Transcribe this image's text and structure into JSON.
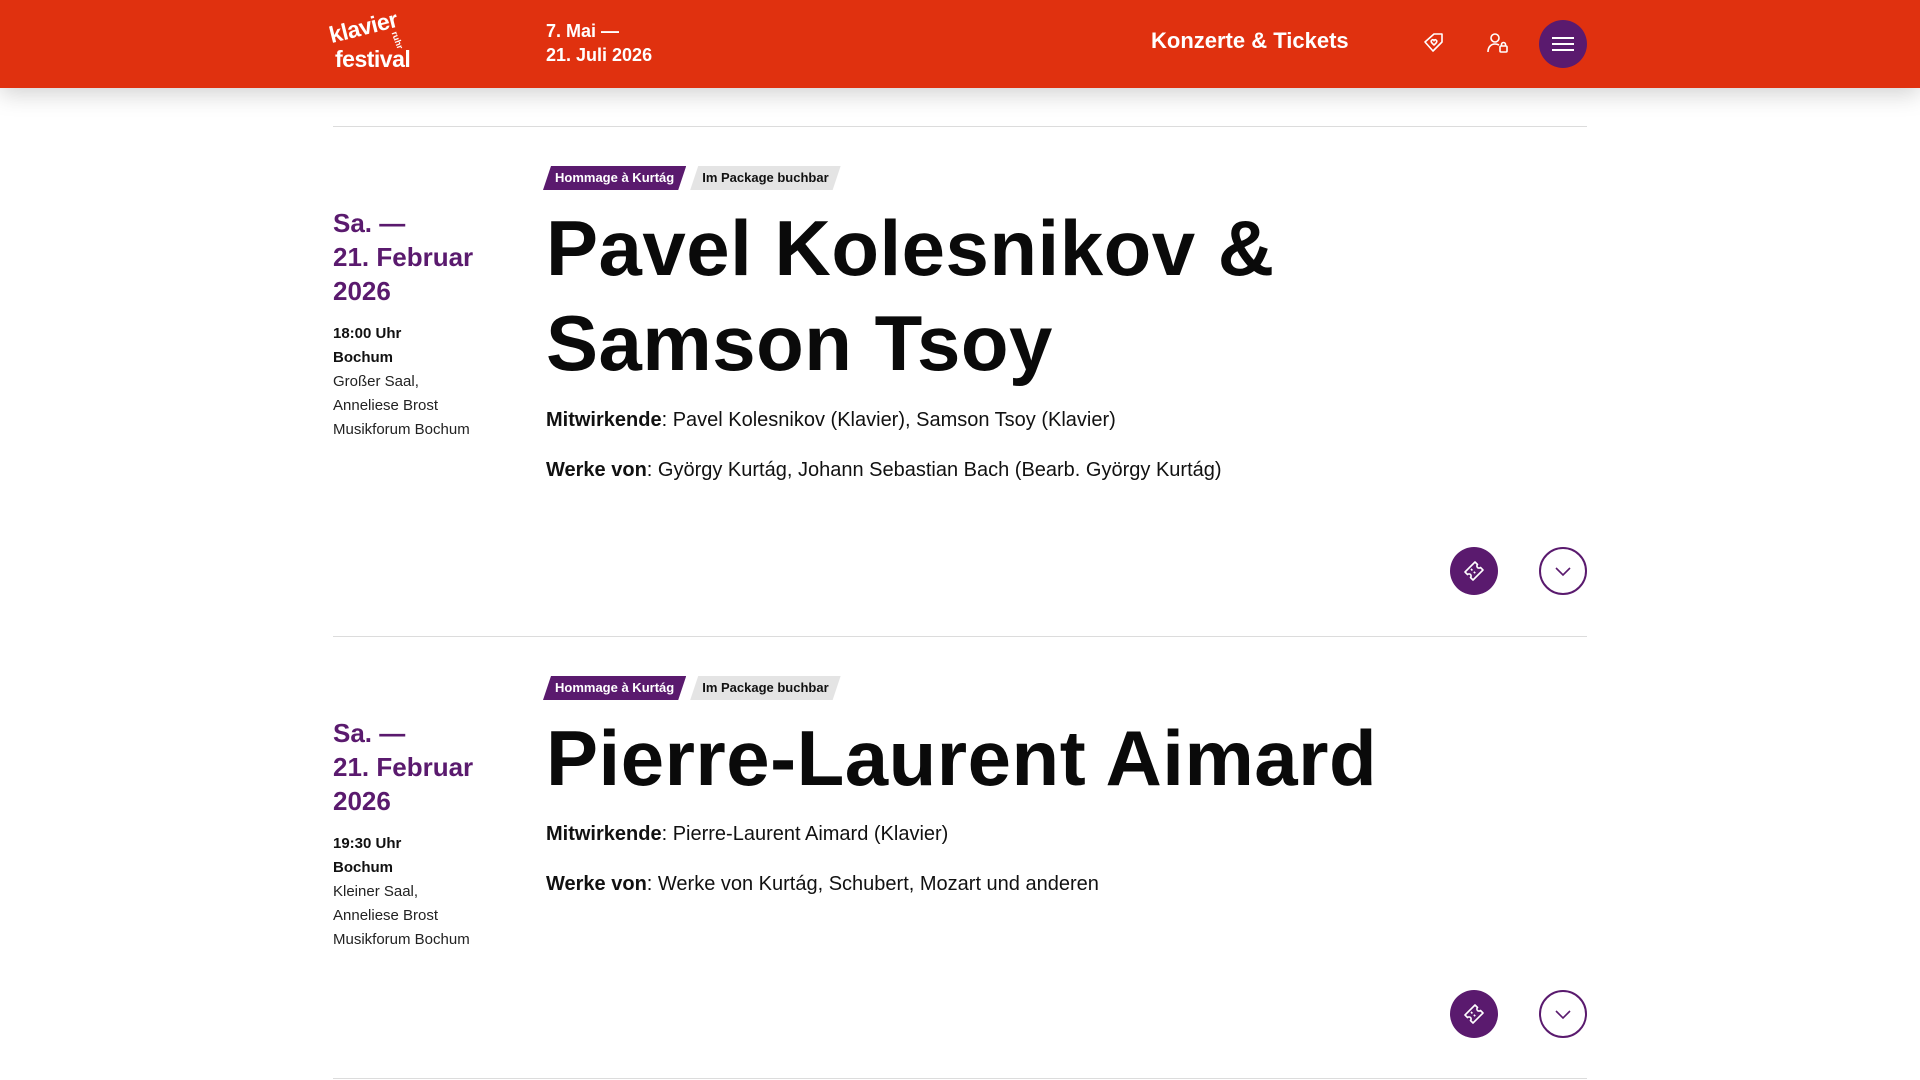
{
  "header": {
    "logo": {
      "top": "klavier",
      "small": "ruhr",
      "bottom": "festival"
    },
    "dates_line1": "7. Mai —",
    "dates_line2": "21. Juli 2026",
    "nav_link": "Konzerte & Tickets",
    "icons": {
      "wishlist": "heart-tag-icon",
      "account": "user-lock-icon",
      "menu": "hamburger-icon"
    },
    "colors": {
      "header_bg": "#e0310f",
      "accent": "#5a1a6e"
    }
  },
  "events": [
    {
      "date_line1": "Sa. —",
      "date_line2": "21. Februar",
      "date_line3": "2026",
      "time": "18:00 Uhr",
      "city": "Bochum",
      "venue_line1": "Großer Saal,",
      "venue_line2": "Anneliese Brost",
      "venue_line3": "Musikforum Bochum",
      "tags": [
        "Hommage à Kurtág",
        "Im Package buchbar"
      ],
      "title_line1": "Pavel Kolesnikov &",
      "title_line2": "Samson Tsoy",
      "performers_label": "Mitwirkende",
      "performers": ": Pavel Kolesnikov (Klavier), Samson Tsoy (Klavier)",
      "works_label": "Werke von",
      "works": ": György Kurtág, Johann Sebastian Bach (Bearb. György Kurtág)",
      "icons": {
        "ticket": "ticket-icon",
        "expand": "chevron-down-icon"
      }
    },
    {
      "date_line1": "Sa. —",
      "date_line2": "21. Februar",
      "date_line3": "2026",
      "time": "19:30 Uhr",
      "city": "Bochum",
      "venue_line1": "Kleiner Saal,",
      "venue_line2": "Anneliese Brost",
      "venue_line3": "Musikforum Bochum",
      "tags": [
        "Hommage à Kurtág",
        "Im Package buchbar"
      ],
      "title_line1": "Pierre-Laurent Aimard",
      "performers_label": "Mitwirkende",
      "performers": ": Pierre-Laurent Aimard (Klavier)",
      "works_label": "Werke von",
      "works": ": Werke von Kurtág, Schubert, Mozart und anderen",
      "icons": {
        "ticket": "ticket-icon",
        "expand": "chevron-down-icon"
      }
    }
  ]
}
